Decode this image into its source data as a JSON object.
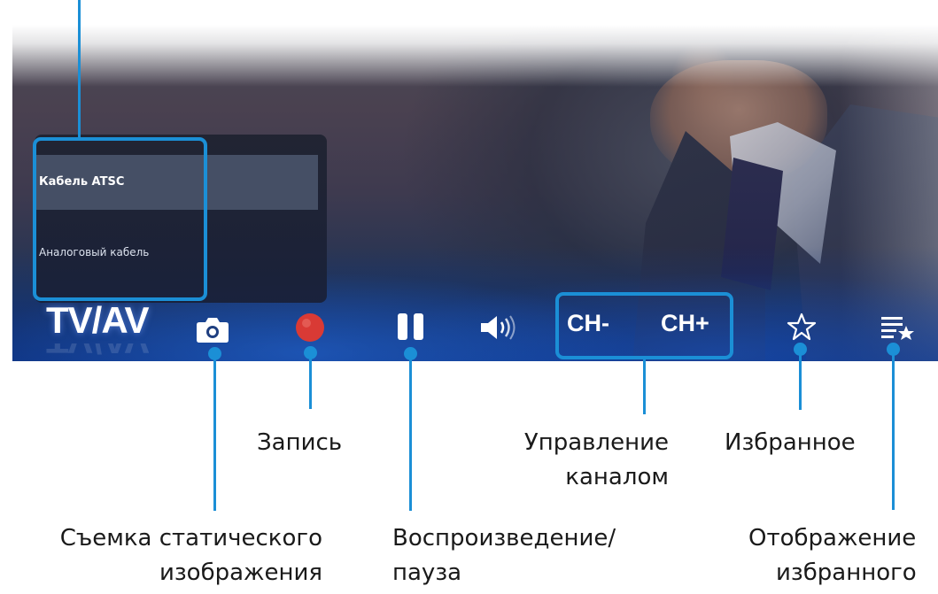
{
  "source_menu": {
    "items": [
      {
        "label": "Кабель ATSC",
        "selected": true
      },
      {
        "label": "Аналоговый кабель",
        "selected": false
      }
    ]
  },
  "control_bar": {
    "tvav_label": "TV/AV",
    "ch_minus_label": "CH-",
    "ch_plus_label": "CH+",
    "icons": [
      "camera-icon",
      "record-icon",
      "pause-icon",
      "speaker-icon",
      "star-icon",
      "favorites-list-icon"
    ]
  },
  "annotations": {
    "record": "Запись",
    "channel_control_line1": "Управление",
    "channel_control_line2": "каналом",
    "favorites": "Избранное",
    "snapshot_line1": "Съемка статического",
    "snapshot_line2": "изображения",
    "play_pause_line1": "Воспроизведение/",
    "play_pause_line2": "пауза",
    "show_favorites_line1": "Отображение",
    "show_favorites_line2": "избранного"
  },
  "colors": {
    "accent": "#1b8fd6",
    "record_red": "#d93a35",
    "text_dark": "#1a1a1a"
  }
}
